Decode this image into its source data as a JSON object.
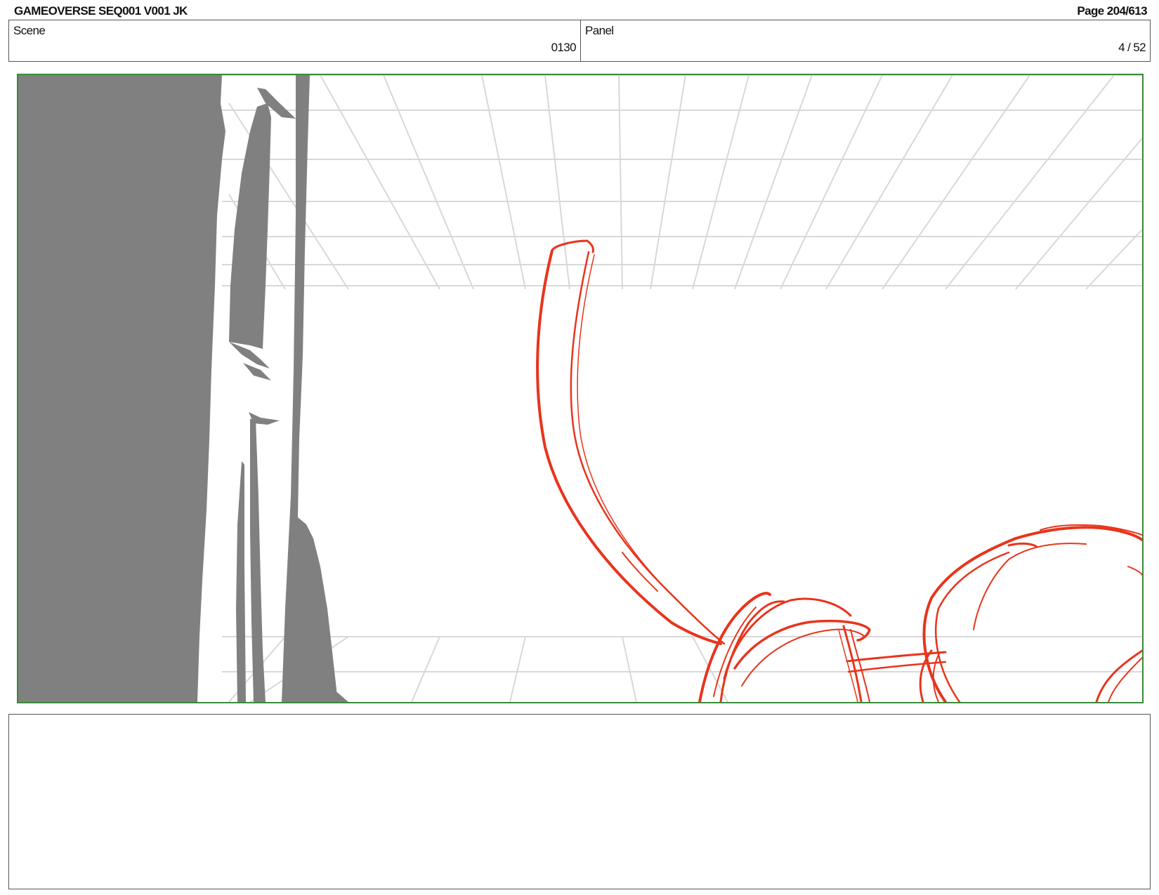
{
  "header": {
    "title": "GAMEOVERSE SEQ001 V001 JK",
    "page": "Page 204/613"
  },
  "info": {
    "scene_label": "Scene",
    "scene_value": "0130",
    "panel_label": "Panel",
    "panel_value": "4 / 52"
  },
  "notes": {
    "text": ""
  },
  "colors": {
    "frame_border": "#3a8a3a",
    "shadow_fill": "#808080",
    "sketch_line": "#e8341c",
    "grid_line": "#d8d8d8"
  }
}
